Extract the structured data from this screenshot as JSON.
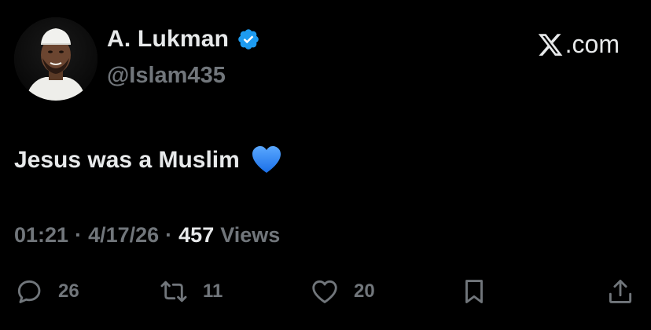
{
  "tweet": {
    "display_name": "A. Lukman",
    "handle": "@Islam435",
    "site": ".com",
    "text": "Jesus was a Muslim",
    "emoji": "blue-heart",
    "time": "01:21",
    "separator": "·",
    "date": "4/17/26",
    "views_count": "457",
    "views_label": "Views"
  },
  "actions": {
    "replies": "26",
    "reposts": "11",
    "likes": "20"
  },
  "icons": {
    "verified": "verified-badge-icon",
    "logo": "x-logo-icon",
    "reply": "reply-icon",
    "repost": "repost-icon",
    "like": "like-icon",
    "bookmark": "bookmark-icon",
    "share": "share-icon"
  },
  "colors": {
    "background": "#000000",
    "primary_text": "#e7e9ea",
    "secondary_text": "#71767b",
    "verified_blue": "#1d9bf0",
    "emoji_blue": "#1e7bf0"
  }
}
